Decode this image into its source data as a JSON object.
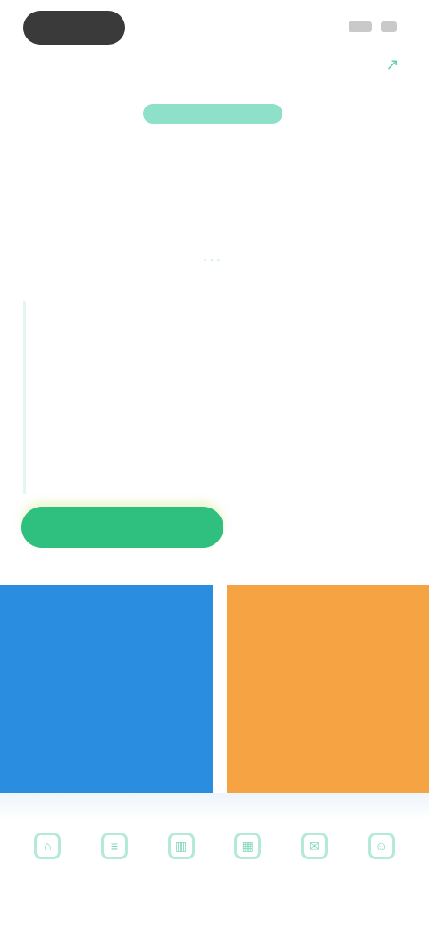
{
  "status_bar": {
    "time_pill": "",
    "icons": [
      "signal-icon",
      "battery-icon"
    ]
  },
  "header": {
    "title": "",
    "action_icon": "share-icon"
  },
  "tag": {
    "label": ""
  },
  "headline": {
    "text": ""
  },
  "body": {
    "paragraphs": [
      "",
      "",
      "",
      ""
    ]
  },
  "primary_button": {
    "label": ""
  },
  "feature_cards": [
    {
      "label": "",
      "value": "",
      "note": "",
      "color": "#2a8de0"
    },
    {
      "label": "",
      "value": "",
      "note": "",
      "color": "#f6a344"
    }
  ],
  "tabs": [
    {
      "icon": "home-icon",
      "label": ""
    },
    {
      "icon": "list-icon",
      "label": ""
    },
    {
      "icon": "chart-icon",
      "label": ""
    },
    {
      "icon": "calendar-icon",
      "label": ""
    },
    {
      "icon": "message-icon",
      "label": ""
    },
    {
      "icon": "user-icon",
      "label": ""
    }
  ],
  "colors": {
    "accent": "#2fc07f",
    "tag": "#8fe0c8",
    "blue_card": "#2a8de0",
    "orange_card": "#f6a344"
  }
}
